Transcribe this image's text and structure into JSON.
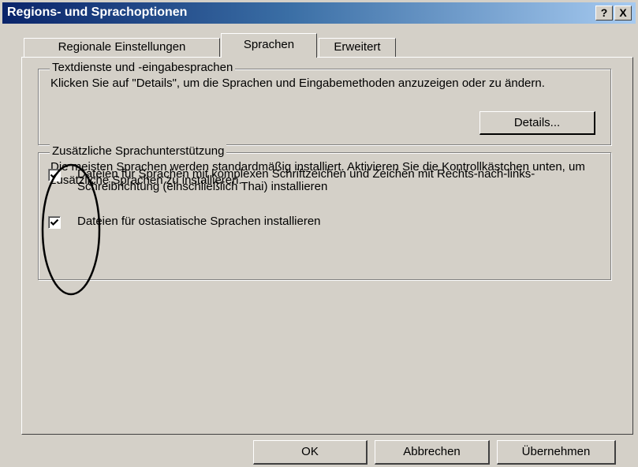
{
  "window": {
    "title": "Regions- und Sprachoptionen",
    "help_label": "?",
    "close_label": "X"
  },
  "tabs": [
    {
      "label": "Regionale Einstellungen",
      "selected": false
    },
    {
      "label": "Sprachen",
      "selected": true
    },
    {
      "label": "Erweitert",
      "selected": false
    }
  ],
  "text_services": {
    "legend": "Textdienste und -eingabesprachen",
    "description": "Klicken Sie auf \"Details\", um die Sprachen und Eingabemethoden anzuzeigen oder zu ändern.",
    "details_label": "Details..."
  },
  "supplemental": {
    "legend": "Zusätzliche Sprachunterstützung",
    "description": "Die meisten Sprachen werden standardmäßig installiert. Aktivieren Sie die Kontrollkästchen unten, um zusätzliche Sprachen zu installieren.",
    "checkboxes": [
      {
        "label": "Dateien für Sprachen mit komplexen Schriftzeichen und Zeichen mit Rechts-nach-links-Schreibrichtung (einschließlich Thai) installieren",
        "checked": true
      },
      {
        "label": "Dateien für ostasiatische Sprachen installieren",
        "checked": true
      }
    ]
  },
  "footer": {
    "ok_label": "OK",
    "cancel_label": "Abbrechen",
    "apply_label": "Übernehmen"
  },
  "colors": {
    "title_gradient_start": "#0a246a",
    "title_gradient_end": "#a6caf0",
    "face": "#d4d0c8"
  }
}
